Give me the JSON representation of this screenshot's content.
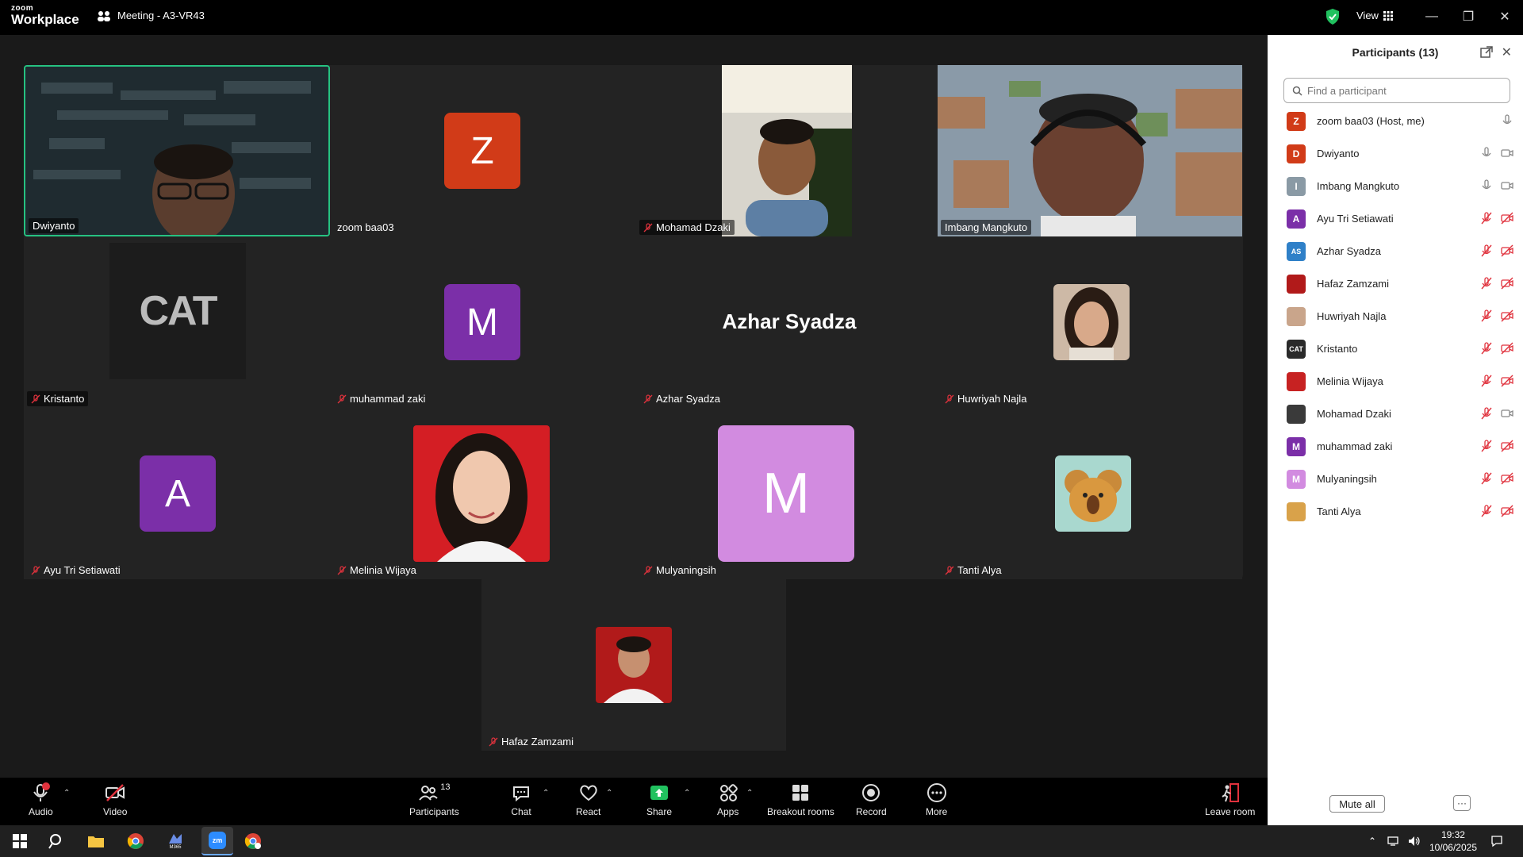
{
  "app": {
    "logo_top": "zoom",
    "logo_bottom": "Workplace",
    "meeting_title": "Meeting - A3-VR43",
    "view_label": "View"
  },
  "tiles": {
    "dwiyanto": "Dwiyanto",
    "zoom_baa03": "zoom baa03",
    "zoom_baa03_initial": "Z",
    "mohamad_dzaki": "Mohamad Dzaki",
    "imbang": "Imbang Mangkuto",
    "kristanto": "Kristanto",
    "muhammad_zaki": "muhammad zaki",
    "muhammad_zaki_initial": "M",
    "azhar": "Azhar Syadza",
    "azhar_center": "Azhar Syadza",
    "huwriyah": "Huwriyah Najla",
    "ayu": "Ayu Tri Setiawati",
    "ayu_initial": "A",
    "melinia": "Melinia Wijaya",
    "mulyaningsih": "Mulyaningsih",
    "mulyaningsih_initial": "M",
    "tanti": "Tanti Alya",
    "hafaz": "Hafaz Zamzami",
    "kristanto_logo": "CAT"
  },
  "panel": {
    "title": "Participants (13)",
    "search_placeholder": "Find a participant",
    "mute_all": "Mute all",
    "more": "···",
    "participants": [
      {
        "initial": "Z",
        "name": "zoom baa03 (Host, me)",
        "color": "#d13b18"
      },
      {
        "initial": "D",
        "name": "Dwiyanto",
        "color": "#d13b18"
      },
      {
        "initial": "I",
        "name": "Imbang Mangkuto",
        "color": "#8a9aa5"
      },
      {
        "initial": "A",
        "name": "Ayu Tri Setiawati",
        "color": "#7b2fa8"
      },
      {
        "initial": "AS",
        "name": "Azhar Syadza",
        "color": "#2f80c8"
      },
      {
        "initial": "",
        "name": "Hafaz Zamzami",
        "color": "#b11a1a"
      },
      {
        "initial": "",
        "name": "Huwriyah Najla",
        "color": "#c9a58b"
      },
      {
        "initial": "CAT",
        "name": "Kristanto",
        "color": "#2a2a2a"
      },
      {
        "initial": "",
        "name": "Melinia Wijaya",
        "color": "#c72222"
      },
      {
        "initial": "",
        "name": "Mohamad Dzaki",
        "color": "#3a3a3a"
      },
      {
        "initial": "M",
        "name": "muhammad zaki",
        "color": "#7b2fa8"
      },
      {
        "initial": "M",
        "name": "Mulyaningsih",
        "color": "#d28be0"
      },
      {
        "initial": "",
        "name": "Tanti Alya",
        "color": "#d9a24a"
      }
    ]
  },
  "toolbar": {
    "audio": "Audio",
    "video": "Video",
    "participants": "Participants",
    "participants_count": "13",
    "chat": "Chat",
    "react": "React",
    "share": "Share",
    "apps": "Apps",
    "breakout": "Breakout rooms",
    "record": "Record",
    "more": "More",
    "leave": "Leave room"
  },
  "taskbar": {
    "time": "19:32",
    "date": "10/06/2025",
    "m365_label": "M365",
    "zoom_label": "zm"
  },
  "colors": {
    "accent_green": "#26c281",
    "share_green": "#21c15f",
    "muted_red": "#e0323d"
  }
}
